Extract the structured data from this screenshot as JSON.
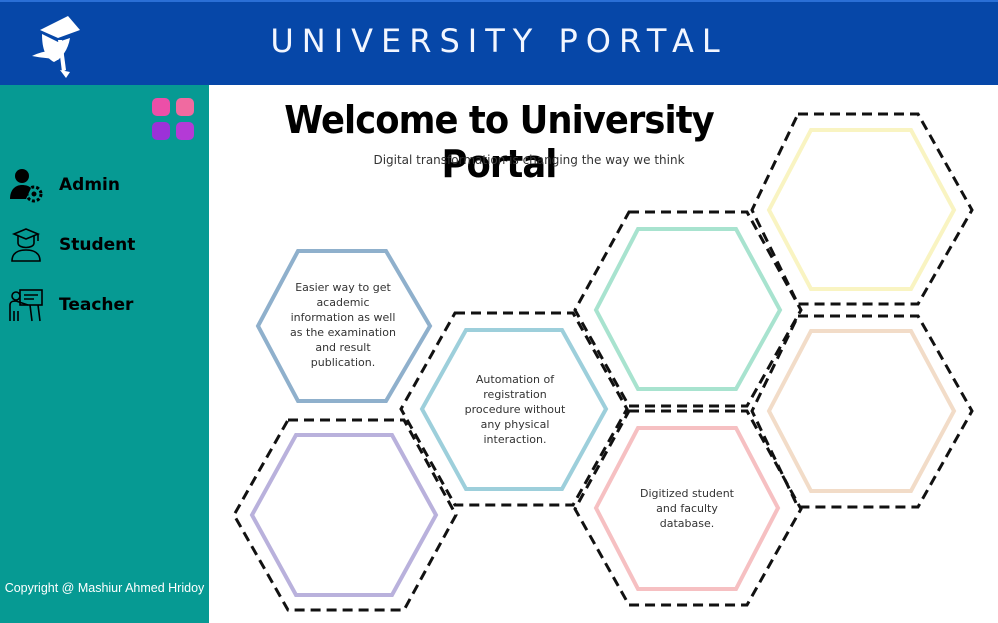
{
  "header": {
    "title": "UNIVERSITY PORTAL",
    "logo_icon": "graduation-cap-icon",
    "background": "#0647a8"
  },
  "sidebar": {
    "background": "#069a93",
    "apps_icon": "apps-grid-icon",
    "items": [
      {
        "label": "Admin",
        "icon": "admin-gear-icon"
      },
      {
        "label": "Student",
        "icon": "student-icon"
      },
      {
        "label": "Teacher",
        "icon": "teacher-icon"
      }
    ],
    "copyright": "Copyright @ Mashiur Ahmed Hridoy"
  },
  "main": {
    "title": "Welcome to University Portal",
    "subtitle": "Digital transformation is changing the way we think",
    "hexagons": [
      {
        "text": "Easier way to get academic information as well as the examination and result publication.",
        "color": "#8fb0cc"
      },
      {
        "text": "Automation of registration procedure without any physical interaction.",
        "color": "#9dcfdb"
      },
      {
        "text": "Digitized student and faculty database.",
        "color": "#f6c0c2"
      },
      {
        "text": "",
        "color": "#a8e3cf"
      },
      {
        "text": "",
        "color": "#f9f4c2"
      },
      {
        "text": "",
        "color": "#f2dcc8"
      },
      {
        "text": "",
        "color": "#b9b1dc"
      }
    ]
  }
}
